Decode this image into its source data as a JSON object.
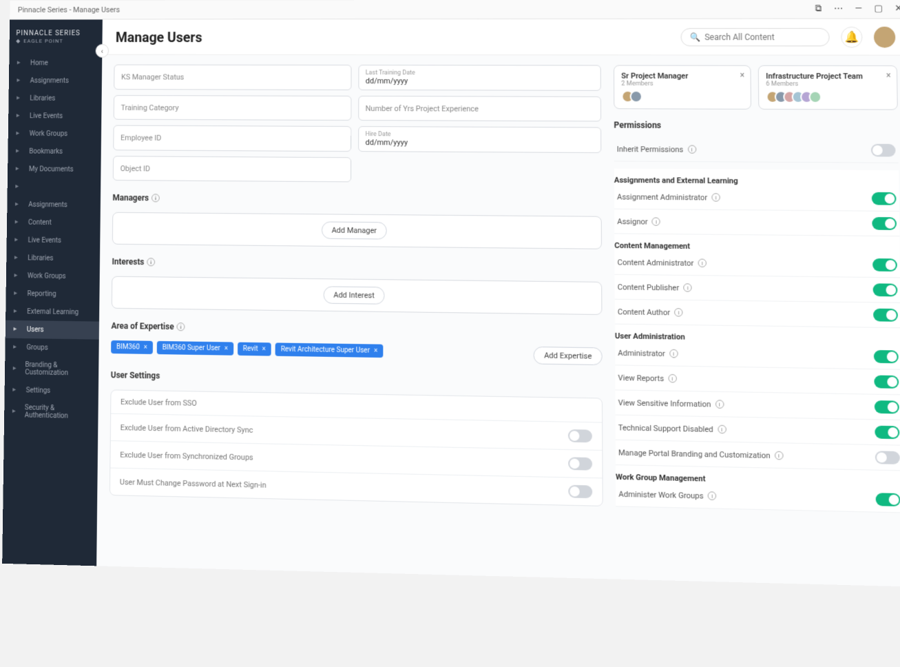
{
  "window": {
    "title": "Pinnacle Series - Manage Users"
  },
  "brand": {
    "line1": "PINNACLE SERIES",
    "line2": "EAGLE POINT"
  },
  "header": {
    "title": "Manage Users",
    "search_placeholder": "Search All Content"
  },
  "sidebar": {
    "items": [
      "Home",
      "Assignments",
      "Libraries",
      "Live Events",
      "Work Groups",
      "Bookmarks",
      "My Documents",
      "",
      "Assignments",
      "Content",
      "Live Events",
      "Libraries",
      "Work Groups",
      "Reporting",
      "External Learning",
      "Users",
      "Groups",
      "Branding & Customization",
      "Settings",
      "Security & Authentication"
    ],
    "active_index": 15
  },
  "fields": {
    "ks_manager_status": "KS Manager Status",
    "last_training_label": "Last Training Date",
    "last_training_value": "dd/mm/yyyy",
    "training_category": "Training Category",
    "num_years_exp": "Number of Yrs Project Experience",
    "employee_id": "Employee ID",
    "hire_date_label": "Hire Date",
    "hire_date_value": "dd/mm/yyyy",
    "object_id": "Object ID"
  },
  "managers": {
    "heading": "Managers",
    "add_btn": "Add Manager"
  },
  "interests": {
    "heading": "Interests",
    "add_btn": "Add Interest"
  },
  "expertise": {
    "heading": "Area of Expertise",
    "add_btn": "Add Expertise",
    "chips": [
      "BIM360",
      "BIM360 Super User",
      "Revit",
      "Revit Architecture Super User"
    ]
  },
  "user_settings": {
    "heading": "User Settings",
    "rows": [
      {
        "label": "Exclude User from SSO",
        "has_toggle": false
      },
      {
        "label": "Exclude User from Active Directory Sync",
        "has_toggle": true,
        "on": false
      },
      {
        "label": "Exclude User from Synchronized Groups",
        "has_toggle": true,
        "on": false
      },
      {
        "label": "User Must Change Password at Next Sign-in",
        "has_toggle": true,
        "on": false
      }
    ]
  },
  "teams": [
    {
      "title": "Sr Project Manager",
      "sub": "2 Members",
      "count": 2
    },
    {
      "title": "Infrastructure Project Team",
      "sub": "6 Members",
      "count": 6
    }
  ],
  "permissions": {
    "heading": "Permissions",
    "inherit_label": "Inherit Permissions",
    "inherit_on": false,
    "groups": [
      {
        "title": "Assignments and External Learning",
        "rows": [
          {
            "label": "Assignment Administrator",
            "on": true
          },
          {
            "label": "Assignor",
            "on": true
          }
        ]
      },
      {
        "title": "Content Management",
        "rows": [
          {
            "label": "Content Administrator",
            "on": true
          },
          {
            "label": "Content Publisher",
            "on": true
          },
          {
            "label": "Content Author",
            "on": true
          }
        ]
      },
      {
        "title": "User Administration",
        "rows": [
          {
            "label": "Administrator",
            "on": true
          },
          {
            "label": "View Reports",
            "on": true
          },
          {
            "label": "View Sensitive Information",
            "on": true
          },
          {
            "label": "Technical Support Disabled",
            "on": true
          },
          {
            "label": "Manage Portal Branding and Customization",
            "on": false
          }
        ]
      },
      {
        "title": "Work Group Management",
        "rows": [
          {
            "label": "Administer Work Groups",
            "on": true
          }
        ]
      }
    ]
  },
  "colors": {
    "accent": "#2f80ed",
    "toggle_on": "#10b981",
    "sidebar_bg": "#1f2937"
  }
}
